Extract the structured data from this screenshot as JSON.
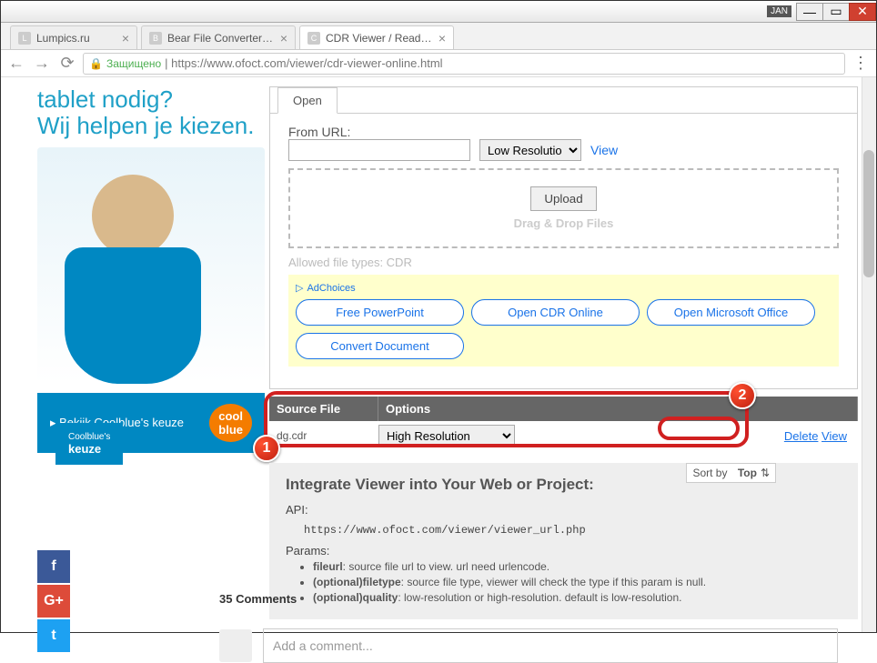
{
  "window": {
    "lang": "JAN"
  },
  "tabs": [
    {
      "title": "Lumpics.ru",
      "active": false
    },
    {
      "title": "Bear File Converter - Onl",
      "active": false
    },
    {
      "title": "CDR Viewer / Reader Onl",
      "active": true
    }
  ],
  "address": {
    "secure_label": "Защищено",
    "url": "https://www.ofoct.com/viewer/cdr-viewer-online.html"
  },
  "ad": {
    "headline": "tablet nodig?\nWij helpen je kiezen.",
    "badge_small": "Coolblue's",
    "badge_big": "keuze",
    "cta": "Bekijk Coolblue's keuze",
    "logo": "cool\nblue"
  },
  "share": {
    "fb": "f",
    "gp": "G+",
    "tw": "t"
  },
  "comments": {
    "count": "35 Comments",
    "placeholder": "Add a comment..."
  },
  "viewer": {
    "open_tab": "Open",
    "from_url": "From URL:",
    "resolution_url": "Low Resolutio",
    "view_link": "View",
    "upload": "Upload",
    "drag_drop": "Drag & Drop Files",
    "allowed": "Allowed file types: CDR",
    "adchoices": "AdChoices",
    "ad_buttons": [
      "Free PowerPoint",
      "Open CDR Online",
      "Open Microsoft Office",
      "Convert Document"
    ],
    "th_source": "Source File",
    "th_options": "Options",
    "file_name": "dg.cdr",
    "file_res": "High Resolution",
    "delete": "Delete",
    "view": "View",
    "integrate": {
      "title": "Integrate Viewer into Your Web or Project:",
      "api_label": "API:",
      "api_url": "https://www.ofoct.com/viewer/viewer_url.php",
      "params_label": "Params:",
      "p1_b": "fileurl",
      "p1": ": source file url to view. url need urlencode.",
      "p2_b": "(optional)filetype",
      "p2": ": source file type, viewer will check the type if this param is null.",
      "p3_b": "(optional)quality",
      "p3": ": low-resolution or high-resolution. default is low-resolution."
    },
    "sortby": "Sort by",
    "sortval": "Top"
  },
  "badges": {
    "one": "1",
    "two": "2"
  }
}
